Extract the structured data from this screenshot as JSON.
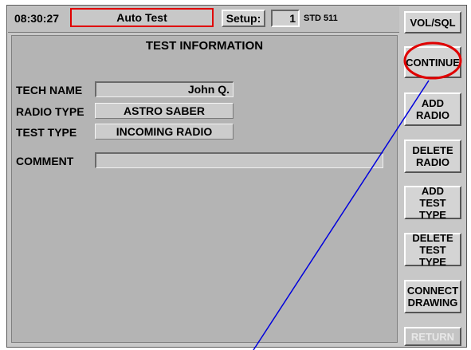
{
  "header": {
    "time": "08:30:27",
    "mode": "Auto Test",
    "setup_label": "Setup:",
    "setup_number": "1",
    "setup_name": "STD 511"
  },
  "panel": {
    "title": "TEST INFORMATION",
    "fields": {
      "tech_name_label": "TECH NAME",
      "tech_name_value": "John Q.",
      "radio_type_label": "RADIO TYPE",
      "radio_type_value": "ASTRO SABER",
      "test_type_label": "TEST TYPE",
      "test_type_value": "INCOMING RADIO",
      "comment_label": "COMMENT",
      "comment_value": ""
    }
  },
  "sidebar": {
    "vol_sql": "VOL/SQL",
    "continue": "CONTINUE",
    "add_radio": "ADD\nRADIO",
    "delete_radio": "DELETE\nRADIO",
    "add_test_type": "ADD TEST\nTYPE",
    "delete_test_type": "DELETE\nTEST TYPE",
    "connect_drawing": "CONNECT\nDRAWING",
    "return": "RETURN"
  },
  "colors": {
    "highlight_ellipse": "#e00000",
    "pointer_line": "#0000dd",
    "mode_box_border": "#e00000"
  }
}
